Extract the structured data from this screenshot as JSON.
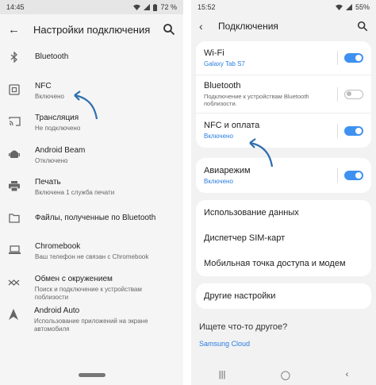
{
  "left": {
    "status": {
      "time": "14:45",
      "battery": "72 %"
    },
    "header": {
      "title": "Настройки подключения"
    },
    "items": [
      {
        "icon": "bluetooth-icon",
        "title": "Bluetooth",
        "subtitle": ""
      },
      {
        "icon": "nfc-icon",
        "title": "NFC",
        "subtitle": "Включено"
      },
      {
        "icon": "cast-icon",
        "title": "Трансляция",
        "subtitle": "Не подключено"
      },
      {
        "icon": "android-beam-icon",
        "title": "Android Beam",
        "subtitle": "Отключено"
      },
      {
        "icon": "printer-icon",
        "title": "Печать",
        "subtitle": "Включена 1 служба печати"
      },
      {
        "icon": "folder-icon",
        "title": "Файлы, полученные по Bluetooth",
        "subtitle": ""
      },
      {
        "icon": "chromebook-icon",
        "title": "Chromebook",
        "subtitle": "Ваш телефон не связан с Chromebook"
      },
      {
        "icon": "nearby-share-icon",
        "title": "Обмен с окружением",
        "subtitle": "Поиск и подключение к устройствам поблизости"
      },
      {
        "icon": "android-auto-icon",
        "title": "Android Auto",
        "subtitle": "Использование приложений на экране автомобиля"
      }
    ]
  },
  "right": {
    "status": {
      "time": "15:52",
      "battery": "55%"
    },
    "header": {
      "title": "Подключения"
    },
    "card1": [
      {
        "title": "Wi-Fi",
        "subtitle": "Galaxy Tab S7",
        "toggle": "on"
      },
      {
        "title": "Bluetooth",
        "subtitle": "Подключение к устройствам Bluetooth поблизости.",
        "toggle": "off"
      },
      {
        "title": "NFC и оплата",
        "subtitle": "Включено",
        "toggle": "on"
      }
    ],
    "card2": [
      {
        "title": "Авиарежим",
        "subtitle": "Включено",
        "toggle": "on"
      }
    ],
    "card3": [
      {
        "title": "Использование данных"
      },
      {
        "title": "Диспетчер SIM-карт"
      },
      {
        "title": "Мобильная точка доступа и модем"
      }
    ],
    "card4": [
      {
        "title": "Другие настройки"
      }
    ],
    "search_card": {
      "title": "Ищете что-то другое?",
      "link": "Samsung Cloud"
    },
    "colors": {
      "accent": "#3e91f1",
      "link": "#2a7de1"
    }
  }
}
